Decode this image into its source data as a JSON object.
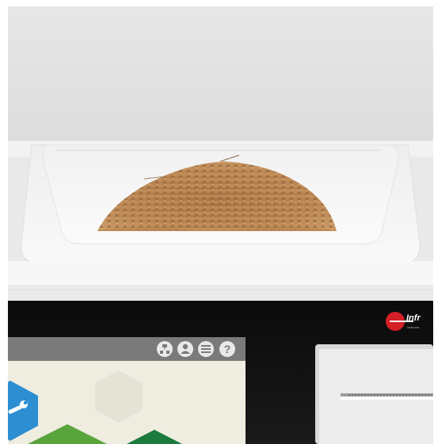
{
  "photo": {
    "subject": "grain-sample-tray-on-analyzer",
    "colors": {
      "wall": "#e2e2e2",
      "tray": "#f6f6f6",
      "grain": "#b98655",
      "device": "#141414",
      "screen_bar": "#7a7a7a",
      "screen_bg": "#efece0",
      "tile_blue": "#2d8fd2",
      "tile_green": "#5aa53b",
      "tile_dark_green": "#1c7a3c",
      "brand_red": "#d41f26"
    }
  },
  "device": {
    "brand_text": "Infr",
    "brand_subtext": "instrume",
    "toolbar_icons": [
      "network-icon",
      "user-icon",
      "menu-icon",
      "help-icon"
    ],
    "help_glyph": "?",
    "tile_icon": "wrench-icon"
  }
}
